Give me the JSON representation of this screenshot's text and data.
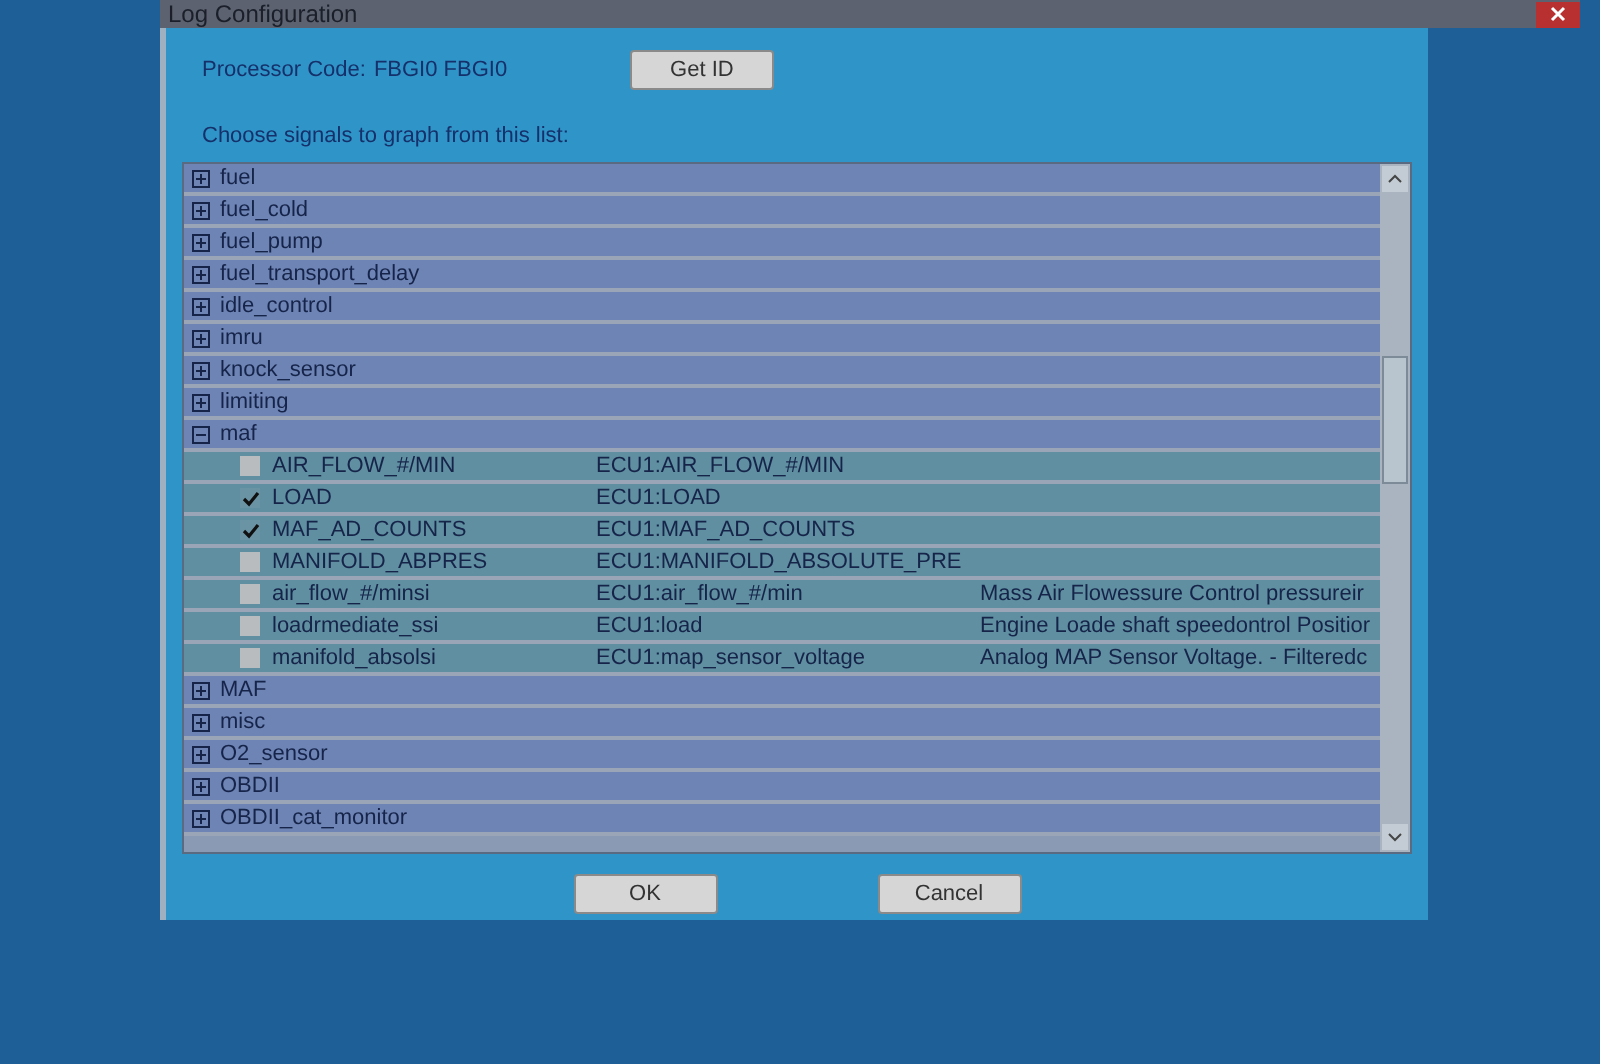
{
  "window": {
    "title": "Log Configuration"
  },
  "header": {
    "processor_label": "Processor Code:",
    "processor_value": "FBGI0 FBGI0",
    "get_id_button": "Get ID",
    "prompt": "Choose signals to graph from this list:"
  },
  "tree": [
    {
      "label": "fuel",
      "expanded": false
    },
    {
      "label": "fuel_cold",
      "expanded": false
    },
    {
      "label": "fuel_pump",
      "expanded": false
    },
    {
      "label": "fuel_transport_delay",
      "expanded": false
    },
    {
      "label": "idle_control",
      "expanded": false
    },
    {
      "label": "imru",
      "expanded": false
    },
    {
      "label": "knock_sensor",
      "expanded": false
    },
    {
      "label": "limiting",
      "expanded": false
    },
    {
      "label": "maf",
      "expanded": true,
      "children": [
        {
          "label": "AIR_FLOW_#/MIN",
          "signal": "ECU1:AIR_FLOW_#/MIN",
          "checked": false
        },
        {
          "label": "LOAD",
          "signal": "ECU1:LOAD",
          "checked": true
        },
        {
          "label": "MAF_AD_COUNTS",
          "signal": "ECU1:MAF_AD_COUNTS",
          "checked": true
        },
        {
          "label": "MANIFOLD_ABPRES",
          "signal": "ECU1:MANIFOLD_ABSOLUTE_PRE",
          "checked": false
        },
        {
          "label": "air_flow_#/minsi",
          "signal": "ECU1:air_flow_#/min",
          "description": "Mass Air Flowessure Control pressureir",
          "checked": false
        },
        {
          "label": "loadrmediate_ssi",
          "signal": "ECU1:load",
          "description": "Engine Loade shaft speedontrol Positior",
          "checked": false
        },
        {
          "label": "manifold_absolsi",
          "signal": "ECU1:map_sensor_voltage",
          "description": "Analog MAP Sensor Voltage. - Filteredc",
          "checked": false
        }
      ]
    },
    {
      "label": "MAF",
      "expanded": false
    },
    {
      "label": "misc",
      "expanded": false
    },
    {
      "label": "O2_sensor",
      "expanded": false
    },
    {
      "label": "OBDII",
      "expanded": false
    },
    {
      "label": "OBDII_cat_monitor",
      "expanded": false
    }
  ],
  "buttons": [
    {
      "label": "OK"
    },
    {
      "label": "Cancel"
    }
  ]
}
